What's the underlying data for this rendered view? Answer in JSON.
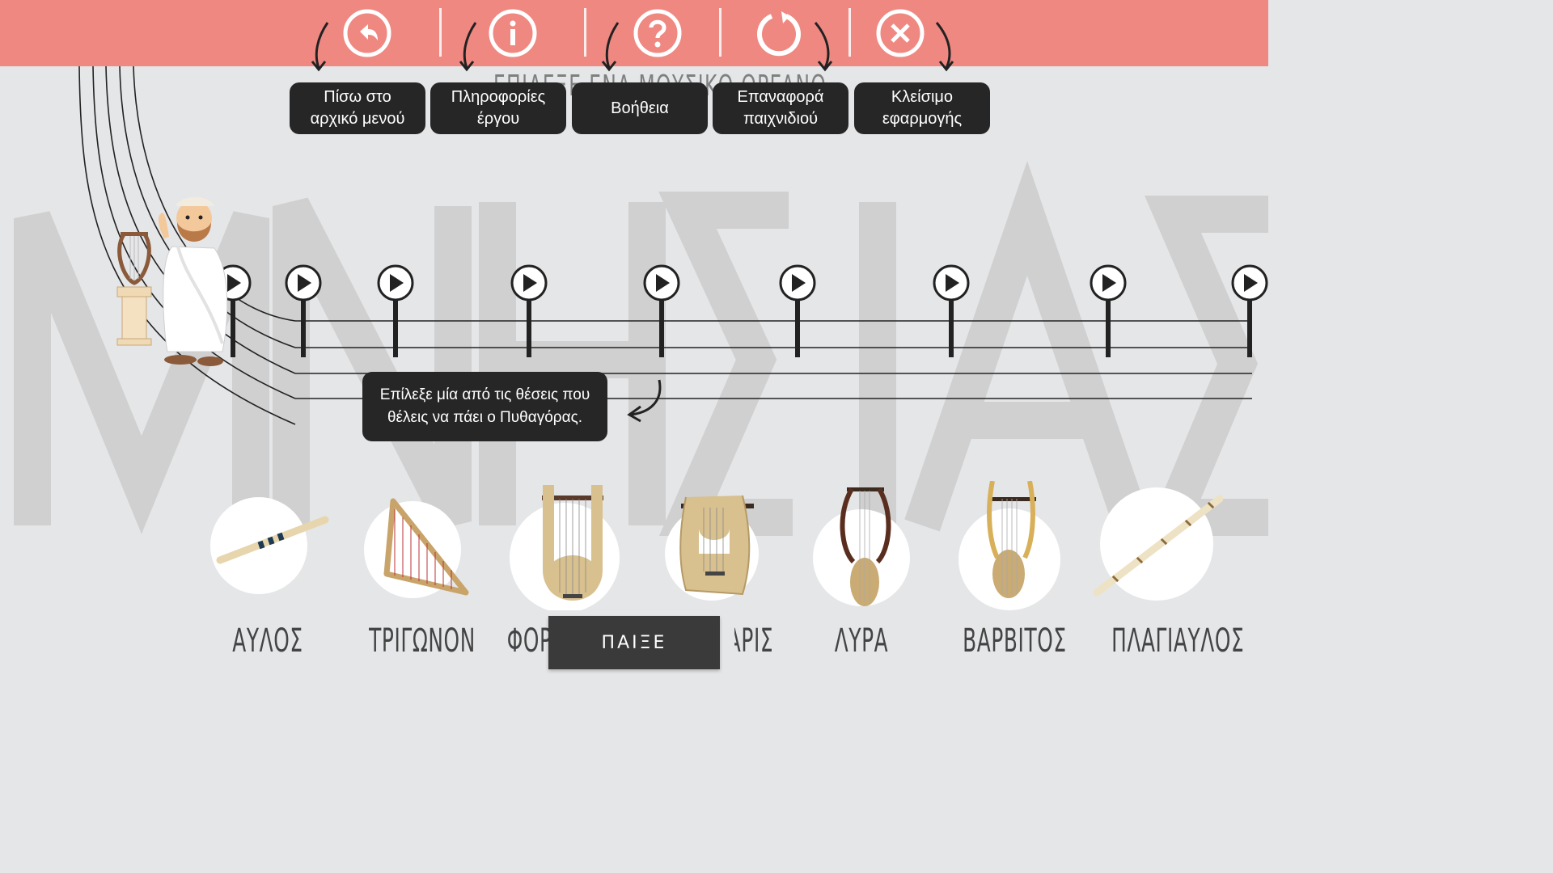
{
  "toolbar": {
    "bar_color": "#f08882",
    "buttons": [
      {
        "icon": "back-arrow-icon",
        "tooltip_line1": "Πίσω στο",
        "tooltip_line2": "αρχικό μενού"
      },
      {
        "icon": "info-icon",
        "tooltip_line1": "Πληροφορίες",
        "tooltip_line2": "έργου"
      },
      {
        "icon": "help-icon",
        "tooltip_line1": "Βοήθεια",
        "tooltip_line2": ""
      },
      {
        "icon": "restart-icon",
        "tooltip_line1": "Επαναφορά",
        "tooltip_line2": "παιχνιδιού"
      },
      {
        "icon": "close-icon",
        "tooltip_line1": "Κλείσιμο",
        "tooltip_line2": "εφαρμογής"
      }
    ]
  },
  "background_title": "ΕΠΙΛΕΞΕ ΕΝΑ ΜΟΥΣΙΚΟ ΟΡΓΑΝΟ",
  "watermark": "ΜΝΗΣΙΑΣ",
  "hint": {
    "line1": "Επίλεξε μία από τις θέσεις που",
    "line2": "θέλεις να πάει ο Πυθαγόρας."
  },
  "character": {
    "name": "pythagoras-character"
  },
  "markers": {
    "count": 9,
    "icon": "play-icon"
  },
  "instruments": [
    {
      "label": "ΑΥΛΟΣ",
      "icon": "aulos-icon"
    },
    {
      "label": "ΤΡΙΓΩΝΟΝ",
      "icon": "trigonon-icon"
    },
    {
      "label": "ΦΟΡΜΙΓΞ",
      "icon": "phorminx-icon"
    },
    {
      "label": "ΚΙΘΑΡΙΣ",
      "icon": "kitharis-icon"
    },
    {
      "label": "ΛΥΡΑ",
      "icon": "lyra-icon"
    },
    {
      "label": "ΒΑΡΒΙΤΟΣ",
      "icon": "barbitos-icon"
    },
    {
      "label": "ΠΛΑΓΙΑΥΛΟΣ",
      "icon": "plagiaulos-icon"
    }
  ],
  "play_button": {
    "label": "ΠΑΙΞΕ"
  }
}
